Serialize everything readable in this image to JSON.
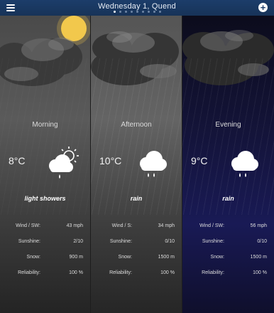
{
  "header": {
    "title": "Wednesday 1, Quend",
    "page_count": 9,
    "active_page": 0,
    "menu_icon": "hamburger-menu-icon",
    "add_icon": "plus-circle-icon"
  },
  "periods": [
    {
      "name": "Morning",
      "temp": "8°C",
      "condition": "light showers",
      "icon": "sun-cloud-rain-icon",
      "rows": [
        {
          "label": "Wind / SW:",
          "value": "43 mph"
        },
        {
          "label": "Sunshine:",
          "value": "2/10"
        },
        {
          "label": "Snow:",
          "value": "900 m"
        },
        {
          "label": "Reliability:",
          "value": "100 %"
        }
      ]
    },
    {
      "name": "Afternoon",
      "temp": "10°C",
      "condition": "rain",
      "icon": "cloud-rain-icon",
      "rows": [
        {
          "label": "Wind / S:",
          "value": "34 mph"
        },
        {
          "label": "Sunshine:",
          "value": "0/10"
        },
        {
          "label": "Snow:",
          "value": "1500 m"
        },
        {
          "label": "Reliability:",
          "value": "100 %"
        }
      ]
    },
    {
      "name": "Evening",
      "temp": "9°C",
      "condition": "rain",
      "icon": "cloud-rain-icon",
      "rows": [
        {
          "label": "Wind / SW:",
          "value": "56 mph"
        },
        {
          "label": "Sunshine:",
          "value": "0/10"
        },
        {
          "label": "Snow:",
          "value": "1500 m"
        },
        {
          "label": "Reliability:",
          "value": "100 %"
        }
      ]
    }
  ],
  "colors": {
    "header": "#1c3d6a",
    "evening_sky": "#191a55",
    "sun": "#f2c94c"
  }
}
